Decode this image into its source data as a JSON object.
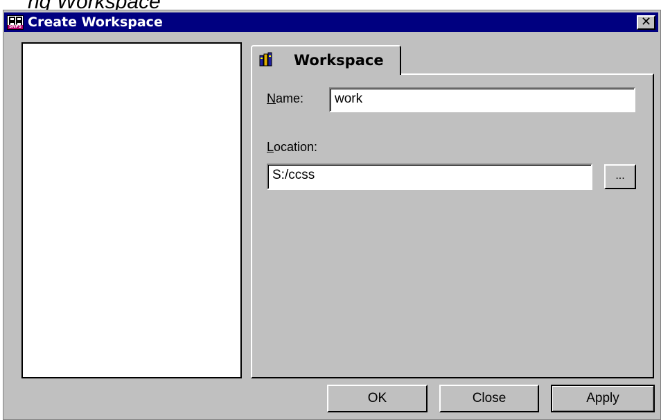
{
  "top_fragment": "ng Workspace",
  "window": {
    "title": "Create Workspace",
    "close_label": "✕",
    "icon_strip_text": "SNPS"
  },
  "tab": {
    "label": "Workspace"
  },
  "form": {
    "name_label_mnemonic": "N",
    "name_label_rest": "ame:",
    "name_value": "work",
    "location_label_mnemonic": "L",
    "location_label_rest": "ocation:",
    "location_value": "S:/ccss",
    "browse_label": "..."
  },
  "buttons": {
    "ok": "OK",
    "close": "Close",
    "apply": "Apply"
  },
  "colors": {
    "titlebar": "#000080",
    "dialog_face": "#c0c0c0",
    "field_bg": "#ffffff"
  }
}
